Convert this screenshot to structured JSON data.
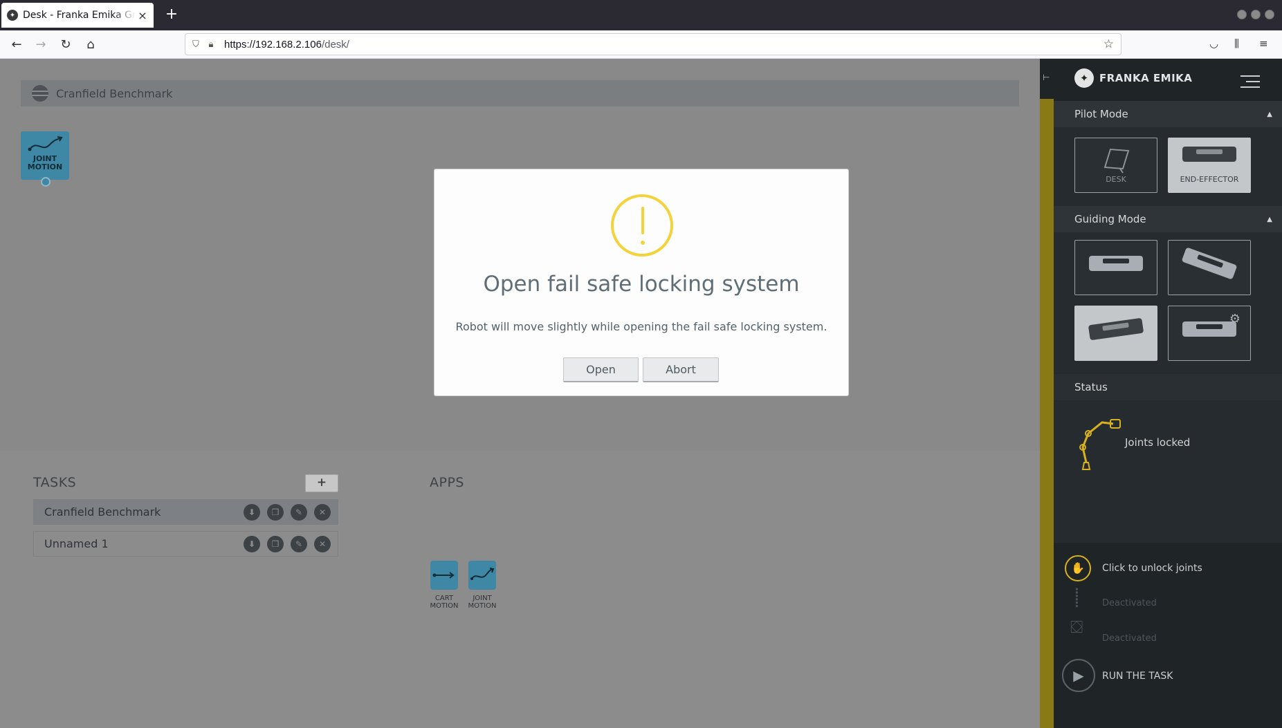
{
  "browser": {
    "tab_title": "Desk - Franka Emika GmbH",
    "tab_close": "×",
    "new_tab": "+",
    "url_host": "https://192.168.2.106",
    "url_path": "/desk/"
  },
  "timeline": {
    "task_name": "Cranfield Benchmark"
  },
  "placed_skill": {
    "label": "JOINT MOTION"
  },
  "tasks": {
    "title": "TASKS",
    "add_label": "+",
    "items": [
      {
        "label": "Cranfield Benchmark",
        "selected": true
      },
      {
        "label": "Unnamed 1",
        "selected": false
      }
    ]
  },
  "apps": {
    "title": "APPS",
    "items": [
      {
        "label": "CART MOTION"
      },
      {
        "label": "JOINT MOTION"
      }
    ]
  },
  "dialog": {
    "title": "Open fail safe locking system",
    "message": "Robot will move slightly while opening the fail safe locking system.",
    "open_label": "Open",
    "abort_label": "Abort"
  },
  "sidebar": {
    "brand": "FRANKA EMIKA",
    "pilot_mode": {
      "title": "Pilot Mode",
      "options": [
        {
          "label": "DESK",
          "active": false
        },
        {
          "label": "END-EFFECTOR",
          "active": true
        }
      ]
    },
    "guiding_mode": {
      "title": "Guiding Mode",
      "active_index": 2
    },
    "status": {
      "title": "Status",
      "text": "Joints locked"
    },
    "actions": {
      "unlock": "Click to unlock joints",
      "deactivated_1": "Deactivated",
      "deactivated_2": "Deactivated",
      "run": "RUN THE TASK"
    }
  },
  "colors": {
    "accent_yellow": "#f3d23a",
    "skill_blue": "#3e87a5",
    "sidebar_dark": "#1f2427"
  }
}
